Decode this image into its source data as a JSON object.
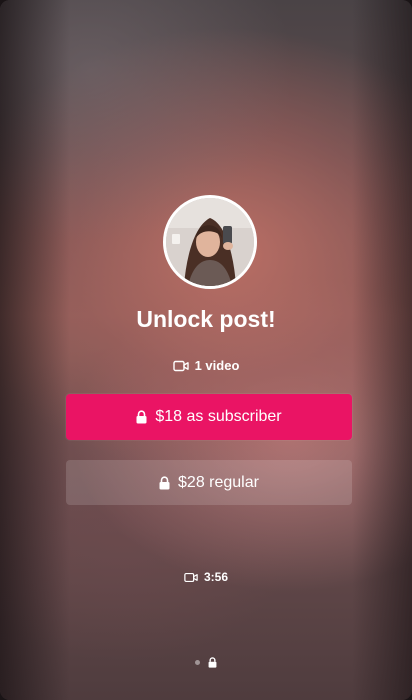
{
  "post": {
    "title": "Unlock post!",
    "media_count_label": "1 video",
    "duration": "3:56"
  },
  "buttons": {
    "subscriber_label": "$18 as subscriber",
    "regular_label": "$28 regular"
  },
  "pagination": {
    "total": 2,
    "current": 2
  },
  "icons": {
    "video": "video-camera-icon",
    "lock": "lock-icon"
  },
  "colors": {
    "accent": "#ea1464",
    "text": "#ffffff"
  }
}
